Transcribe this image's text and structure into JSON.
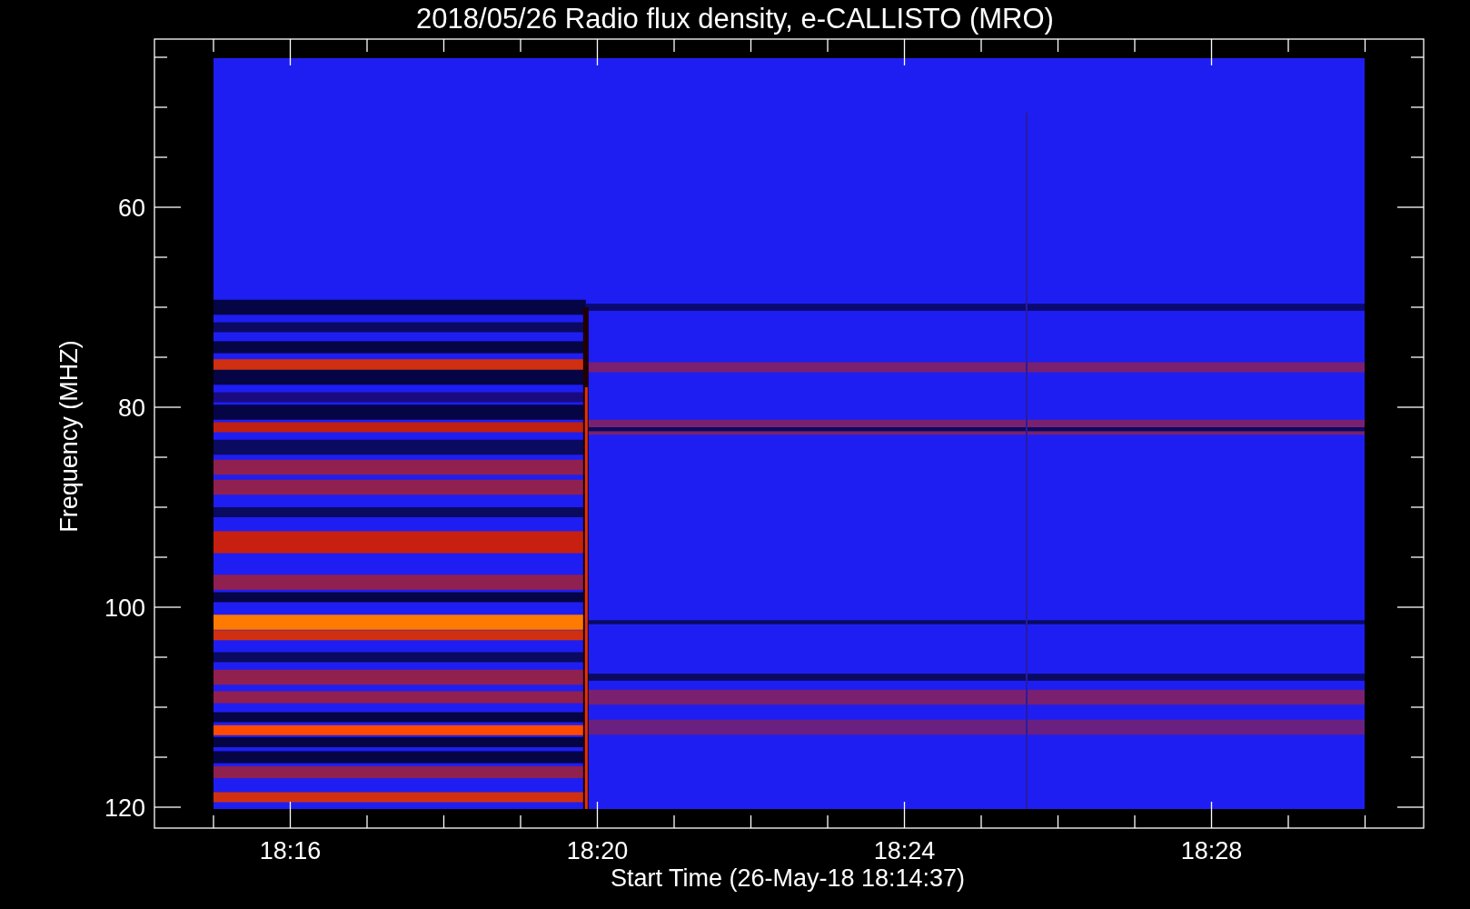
{
  "title": "2018/05/26  Radio flux density, e-CALLISTO (MRO)",
  "plot": {
    "xlabel": "Start Time (26-May-18 18:14:37)",
    "ylabel": "Frequency (MHZ)",
    "xticks": [
      {
        "label": "18:16"
      },
      {
        "label": "18:20"
      },
      {
        "label": "18:24"
      },
      {
        "label": "18:28"
      }
    ],
    "yticks": [
      {
        "label": "60"
      },
      {
        "label": "80"
      },
      {
        "label": "100"
      },
      {
        "label": "120"
      }
    ]
  }
}
